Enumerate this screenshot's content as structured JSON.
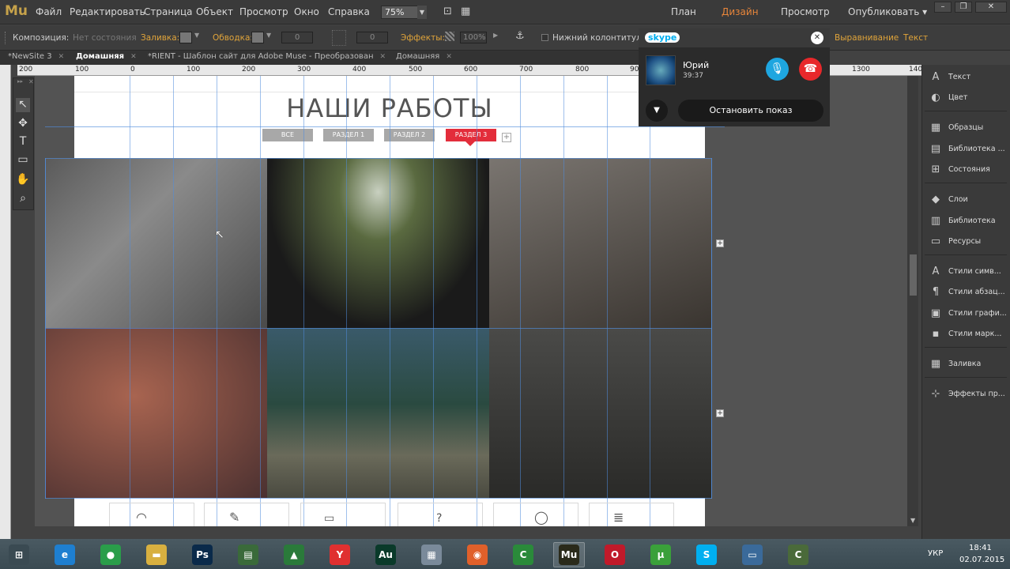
{
  "app": {
    "logo": "Mu"
  },
  "menu": [
    "Файл",
    "Редактировать",
    "Страница",
    "Объект",
    "Просмотр",
    "Окно",
    "Справка"
  ],
  "zoom": "75%",
  "modes": {
    "plan": "План",
    "design": "Дизайн",
    "preview": "Просмотр",
    "publish": "Опубликовать ▾"
  },
  "control": {
    "composition_label": "Композиция:",
    "composition_value": "Нет состояния",
    "fill_label": "Заливка:",
    "stroke_label": "Обводка:",
    "stroke_value": "0",
    "stroke_value2": "0",
    "effects_label": "Эффекты:",
    "opacity": "100%",
    "footer_label": "Нижний колонтитул",
    "align_label": "Выравнивание",
    "text_label": "Текст"
  },
  "tabs": [
    {
      "label": "*NewSite 3"
    },
    {
      "label": "Домашняя"
    },
    {
      "label": "*RIENT - Шаблон сайт для Adobe Muse - Преобразован"
    },
    {
      "label": "Домашняя"
    }
  ],
  "ruler": [
    "200",
    "100",
    "0",
    "100",
    "200",
    "300",
    "400",
    "500",
    "600",
    "700",
    "800",
    "900",
    "1300",
    "140"
  ],
  "page": {
    "title": "НАШИ РАБОТЫ",
    "filters": [
      "ВСЕ",
      "РАЗДЕЛ 1",
      "РАЗДЕЛ 2",
      "РАЗДЕЛ 3"
    ],
    "filter_plus": "+"
  },
  "right_panel": [
    {
      "icon": "A",
      "label": "Текст"
    },
    {
      "icon": "◐",
      "label": "Цвет"
    },
    {
      "icon": "▦",
      "label": "Образцы"
    },
    {
      "icon": "▤",
      "label": "Библиотека ..."
    },
    {
      "icon": "⊞",
      "label": "Состояния"
    },
    {
      "icon": "◆",
      "label": "Слои"
    },
    {
      "icon": "▥",
      "label": "Библиотека"
    },
    {
      "icon": "▭",
      "label": "Ресурсы"
    },
    {
      "icon": "A",
      "label": "Стили симв..."
    },
    {
      "icon": "¶",
      "label": "Стили абзац..."
    },
    {
      "icon": "▣",
      "label": "Стили графи..."
    },
    {
      "icon": "▪",
      "label": "Стили марк..."
    },
    {
      "icon": "▦",
      "label": "Заливка"
    },
    {
      "icon": "⊹",
      "label": "Эффекты пр..."
    }
  ],
  "skype": {
    "logo": "skype",
    "caller": "Юрий",
    "duration": "39:37",
    "stop_label": "Остановить показ"
  },
  "taskbar": {
    "apps": [
      {
        "icon": "start-icon",
        "glyph": "⊞",
        "color": "#3a4a52"
      },
      {
        "icon": "ie-icon",
        "glyph": "e",
        "color": "#1e7fd0"
      },
      {
        "icon": "chrome-icon",
        "glyph": "●",
        "color": "#2a9d4a"
      },
      {
        "icon": "explorer-icon",
        "glyph": "▬",
        "color": "#d8b040"
      },
      {
        "icon": "photoshop-icon",
        "glyph": "Ps",
        "color": "#0a2a4a"
      },
      {
        "icon": "notepad-icon",
        "glyph": "▤",
        "color": "#3a6a3a"
      },
      {
        "icon": "drive-icon",
        "glyph": "▲",
        "color": "#2a7a3a"
      },
      {
        "icon": "yandex-icon",
        "glyph": "Y",
        "color": "#e03030"
      },
      {
        "icon": "audition-icon",
        "glyph": "Au",
        "color": "#0a3a2a"
      },
      {
        "icon": "calculator-icon",
        "glyph": "▦",
        "color": "#7a8a9a"
      },
      {
        "icon": "firefox-icon",
        "glyph": "◉",
        "color": "#e0602a"
      },
      {
        "icon": "camtasia-icon",
        "glyph": "C",
        "color": "#2a8a3a"
      },
      {
        "icon": "muse-icon",
        "glyph": "Mu",
        "color": "#2a2a1a"
      },
      {
        "icon": "opera-icon",
        "glyph": "O",
        "color": "#c01a2a"
      },
      {
        "icon": "utorrent-icon",
        "glyph": "μ",
        "color": "#3aa03a"
      },
      {
        "icon": "skype-icon",
        "glyph": "S",
        "color": "#00aff0"
      },
      {
        "icon": "monitor-icon",
        "glyph": "▭",
        "color": "#3a6a9a"
      },
      {
        "icon": "camtasia-recorder-icon",
        "glyph": "C",
        "color": "#4a6a3a"
      }
    ],
    "lang": "УКР",
    "time": "18:41",
    "date": "02.07.2015"
  }
}
